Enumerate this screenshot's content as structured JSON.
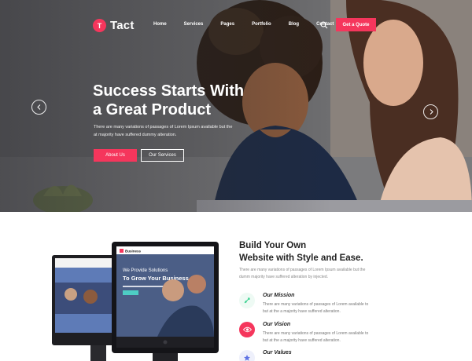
{
  "brand": {
    "badge": "T",
    "name": "Tact",
    "accent": "#f5365c"
  },
  "nav": {
    "links": [
      "Home",
      "Services",
      "Pages",
      "Portfolio",
      "Blog",
      "Contact"
    ],
    "search_icon": "search-icon",
    "cta": "Get a Quote"
  },
  "hero": {
    "title_line1": "Success Starts With",
    "title_line2": "a Great Product",
    "desc_line1": "There are many variations of passages of Lorem Ipsum available but the",
    "desc_line2": "at majority have suffered dummy alteration.",
    "btn_primary": "About Us",
    "btn_secondary": "Our Services",
    "prev_icon": "chevron-left-icon",
    "next_icon": "chevron-right-icon"
  },
  "about": {
    "title_line1": "Build Your Own",
    "title_line2": "Website with Style and Ease.",
    "desc_line1": "There are many variations of passages of Lorem Ipsum available but the",
    "desc_line2": "dumm majority have suffered alteration by injected.",
    "features": [
      {
        "title": "Our Mission",
        "text1": "There are many variations of passages of Lorem available to",
        "text2": "but at the a majority have suffered alteration.",
        "icon": "target-icon",
        "color": "#2dce89"
      },
      {
        "title": "Our Vision",
        "text1": "There are many variations of passages of Lorem available to",
        "text2": "but at the a majority have suffered alteration.",
        "icon": "eye-icon",
        "color": "#f5365c"
      },
      {
        "title": "Our Values",
        "icon": "star-icon",
        "color": "#5e72e4"
      }
    ]
  },
  "monitor": {
    "brand": "Business",
    "headline1": "We Provide Solutions",
    "headline2": "To Grow Your Business"
  }
}
